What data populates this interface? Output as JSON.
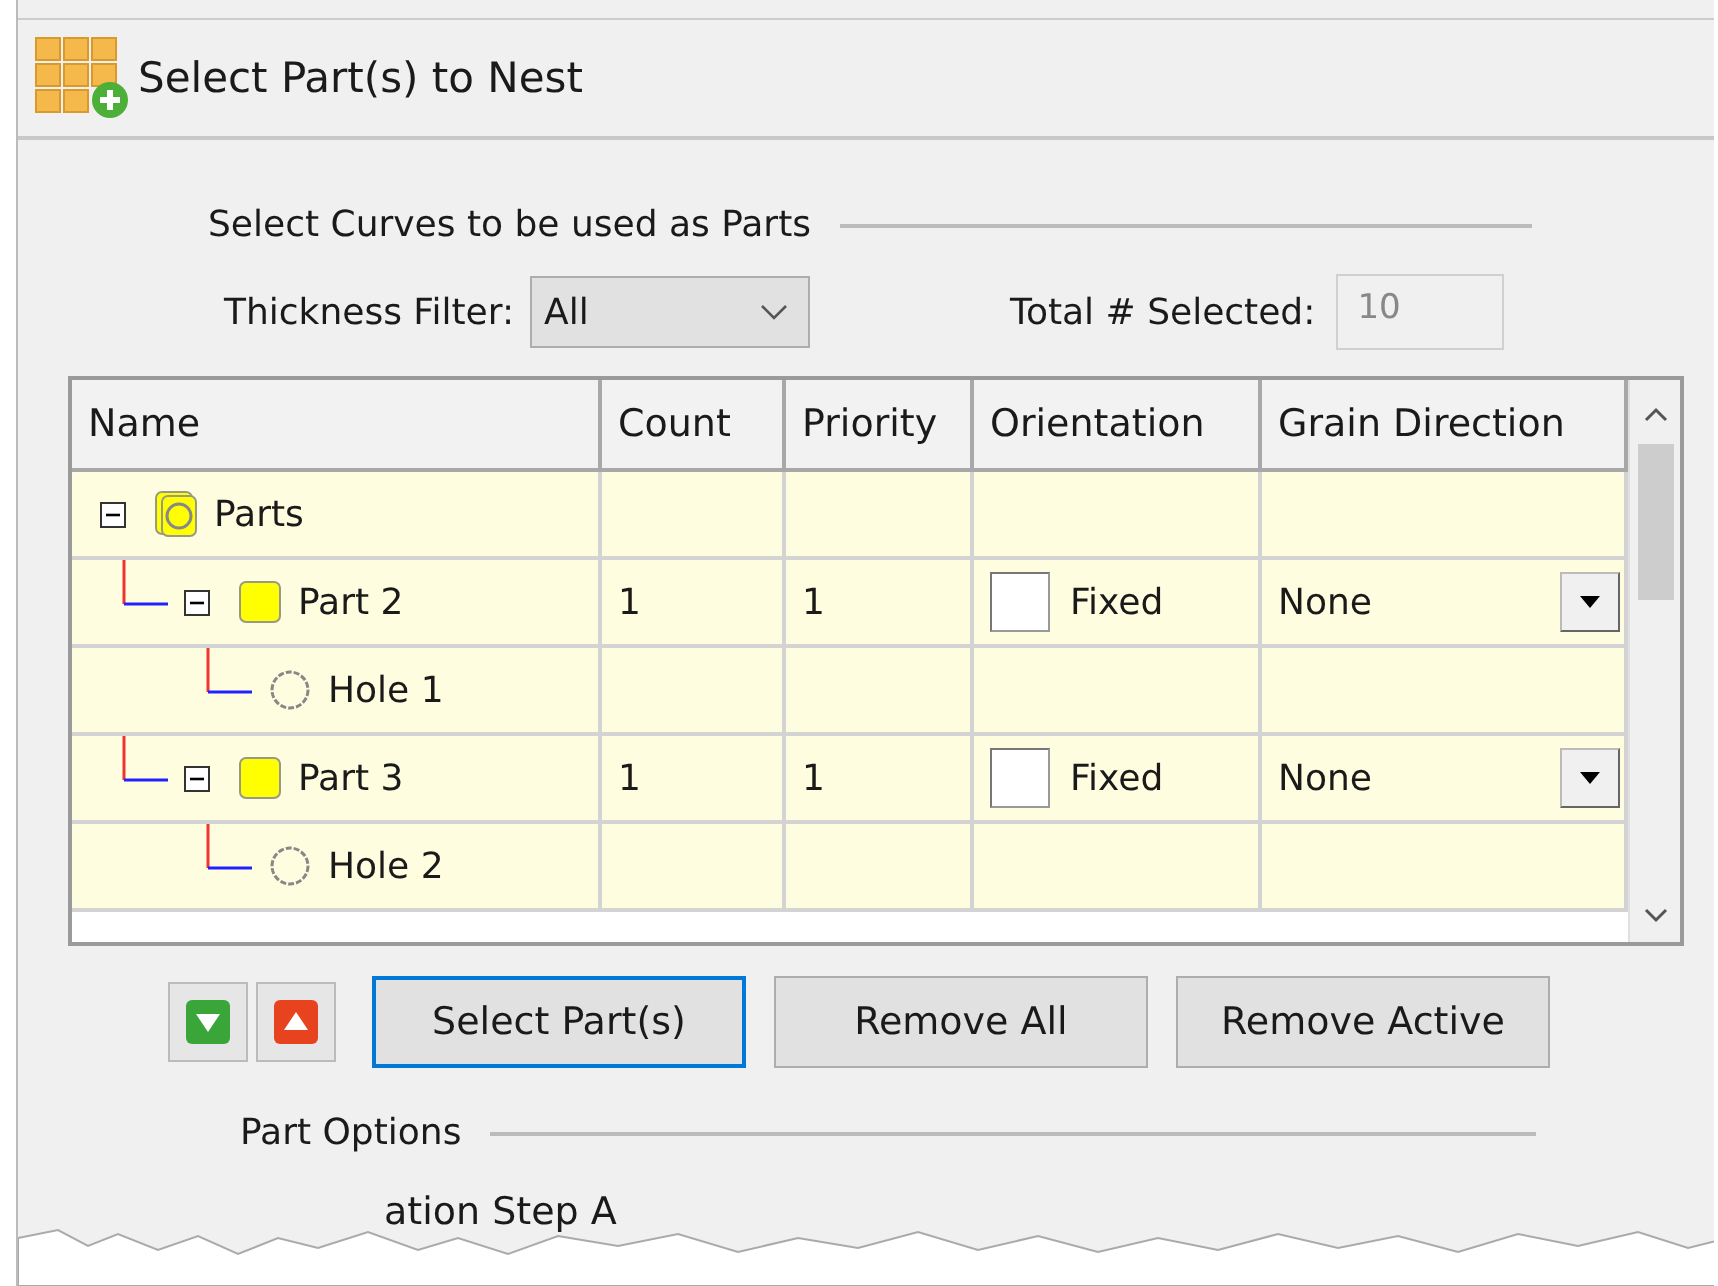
{
  "window": {
    "title": "Select Part(s) to Nest"
  },
  "curves_group": {
    "title": "Select Curves to be used as Parts",
    "thickness_filter": {
      "label": "Thickness Filter:",
      "value": "All"
    },
    "total_selected": {
      "label": "Total # Selected:",
      "value": "10"
    }
  },
  "table": {
    "columns": [
      "Name",
      "Count",
      "Priority",
      "Orientation",
      "Grain Direction"
    ],
    "rows": [
      {
        "kind": "group",
        "name": "Parts",
        "expanded": true,
        "children": [
          {
            "kind": "part",
            "name": "Part 2",
            "count": "1",
            "priority": "1",
            "orientation": {
              "label": "Fixed",
              "checked": false
            },
            "grain": "None",
            "expanded": true,
            "children": [
              {
                "kind": "hole",
                "name": "Hole 1"
              }
            ]
          },
          {
            "kind": "part",
            "name": "Part 3",
            "count": "1",
            "priority": "1",
            "orientation": {
              "label": "Fixed",
              "checked": false
            },
            "grain": "None",
            "expanded": true,
            "children": [
              {
                "kind": "hole",
                "name": "Hole 2"
              }
            ]
          }
        ]
      }
    ]
  },
  "buttons": [
    {
      "kind": "down"
    },
    {
      "kind": "up"
    },
    {
      "kind": "text",
      "label": "Select Part(s)",
      "selected": true
    },
    {
      "kind": "text",
      "label": "Remove All",
      "selected": false
    },
    {
      "kind": "text",
      "label": "Remove Active",
      "selected": false
    }
  ],
  "part_options": {
    "title": "Part Options",
    "step_angle_label": "ation Step A"
  }
}
